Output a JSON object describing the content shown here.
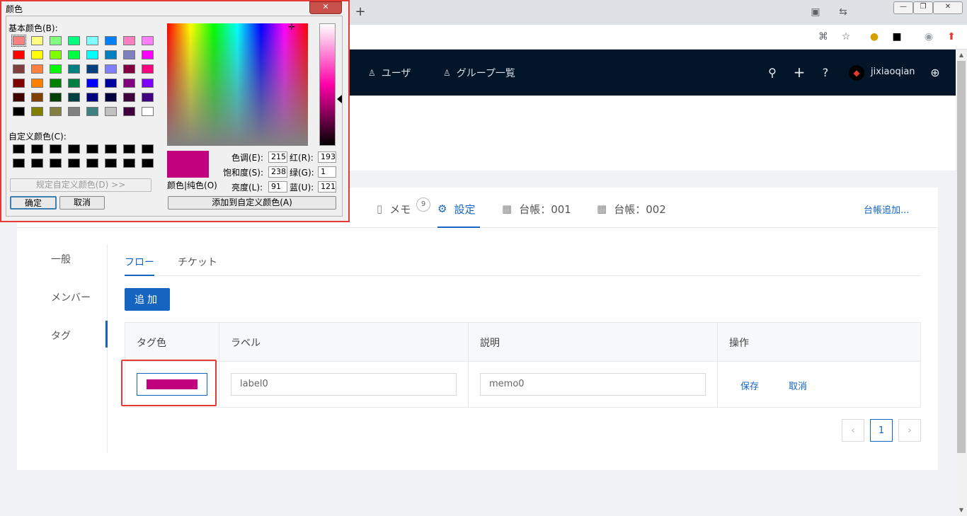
{
  "browser": {
    "window_controls": {
      "minimize": "—",
      "restore": "❐",
      "close": "✕"
    },
    "new_tab": "+"
  },
  "header": {
    "nav_users": "ユーザ",
    "nav_groups": "グループ一覧",
    "username": "jixiaoqian"
  },
  "project_tabs": {
    "memo": "メモ",
    "memo_badge": "9",
    "settings": "設定",
    "ledger1": "台帳：001",
    "ledger2": "台帳：002",
    "add_ledger": "台帳追加..."
  },
  "side_menu": [
    "一般",
    "メンバー",
    "タグ"
  ],
  "sub_tabs": {
    "flow": "フロー",
    "ticket": "チケット"
  },
  "add_button": "追加",
  "table": {
    "headers": [
      "タグ色",
      "ラベル",
      "説明",
      "操作"
    ],
    "row": {
      "color": "#c1017d",
      "label_value": "label0",
      "memo_value": "memo0",
      "save": "保存",
      "cancel": "取消"
    }
  },
  "pagination": {
    "prev": "‹",
    "current": "1",
    "next": "›"
  },
  "color_dialog": {
    "title": "颜色",
    "close": "✕",
    "basic_colors_label": "基本颜色(B):",
    "custom_colors_label": "自定义颜色(C):",
    "define_custom_button": "规定自定义颜色(D) >>",
    "ok_button": "确定",
    "cancel_button": "取消",
    "add_custom_button": "添加到自定义颜色(A)",
    "preview_label": "颜色|纯色(O)",
    "hue_label": "色调(E):",
    "hue_value": "215",
    "sat_label": "饱和度(S):",
    "sat_value": "238",
    "lum_label": "亮度(L):",
    "lum_value": "91",
    "red_label": "红(R):",
    "red_value": "193",
    "green_label": "绿(G):",
    "green_value": "1",
    "blue_label": "蓝(U):",
    "blue_value": "121",
    "selected_color": "#c1017d",
    "basic_colors": [
      "#ff8080",
      "#ffff80",
      "#80ff80",
      "#00ff80",
      "#80ffff",
      "#0080ff",
      "#ff80c0",
      "#ff80ff",
      "#ff0000",
      "#ffff00",
      "#80ff00",
      "#00ff40",
      "#00ffff",
      "#0080c0",
      "#8080c0",
      "#ff00ff",
      "#804040",
      "#ff8040",
      "#00ff00",
      "#008080",
      "#004080",
      "#8080ff",
      "#800040",
      "#ff0080",
      "#800000",
      "#ff8000",
      "#008000",
      "#008040",
      "#0000ff",
      "#0000a0",
      "#800080",
      "#8000ff",
      "#400000",
      "#804000",
      "#004000",
      "#004040",
      "#000080",
      "#000040",
      "#400040",
      "#400080",
      "#000000",
      "#808000",
      "#808040",
      "#808080",
      "#408080",
      "#c0c0c0",
      "#400040",
      "#ffffff"
    ],
    "custom_colors": [
      "#000000",
      "#000000",
      "#000000",
      "#000000",
      "#000000",
      "#000000",
      "#000000",
      "#000000",
      "#000000",
      "#000000",
      "#000000",
      "#000000",
      "#000000",
      "#000000",
      "#000000",
      "#000000"
    ]
  }
}
